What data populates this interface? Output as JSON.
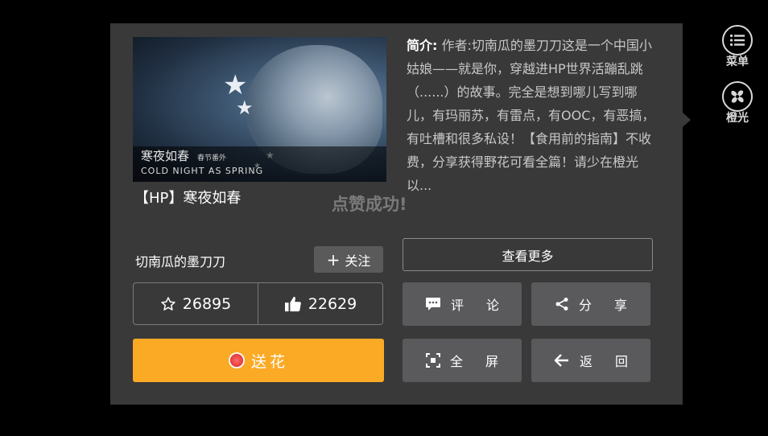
{
  "cover": {
    "caption_cn": "寒夜如春",
    "caption_sub": "春节番外",
    "caption_en": "COLD NIGHT AS SPRING"
  },
  "work": {
    "title": "【HP】寒夜如春",
    "desc_label": "简介:",
    "desc_text": " 作者:切南瓜的墨刀刀这是一个中国小姑娘——就是你，穿越进HP世界活蹦乱跳（......）的故事。完全是想到哪儿写到哪儿，有玛丽苏，有雷点，有OOC，有恶搞，有吐槽和很多私设！【食用前的指南】不收费，分享获得野花可看全篇！请少在橙光以..."
  },
  "toast": "点赞成功!",
  "author": {
    "name": "切南瓜的墨刀刀",
    "follow_label": "关注"
  },
  "stats": {
    "favorites": "26895",
    "likes": "22629"
  },
  "actions": {
    "send_flower": "送花",
    "view_more": "查看更多",
    "comment": "评论",
    "share": "分享",
    "fullscreen": "全屏",
    "back": "返回"
  },
  "side": {
    "menu_label": "菜单",
    "brand_label": "橙光"
  },
  "colors": {
    "panel": "#393939",
    "accent_orange": "#fbaa25",
    "button_gray": "#5a5a5c"
  }
}
